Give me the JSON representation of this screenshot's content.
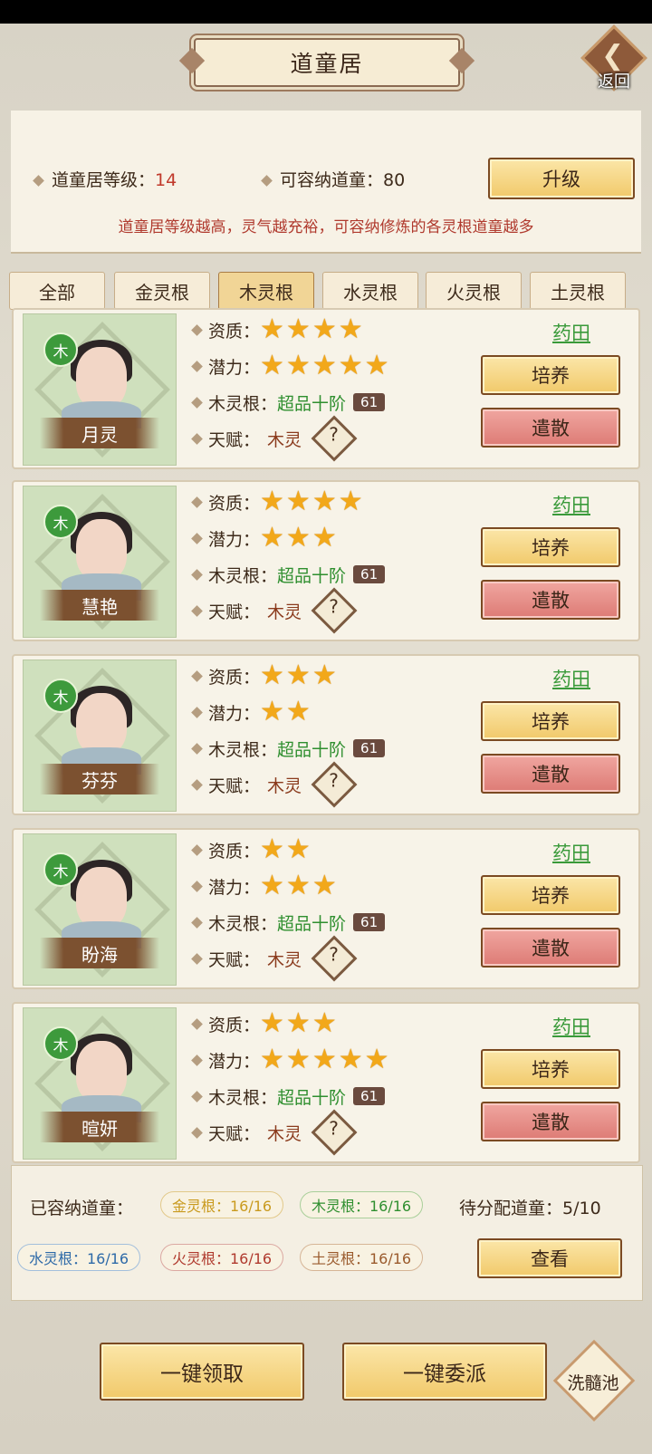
{
  "header": {
    "title": "道童居",
    "back_label": "返回"
  },
  "info": {
    "level_label": "道童居等级：",
    "level_value": "14",
    "capacity_label": "可容纳道童：",
    "capacity_value": "80",
    "upgrade_label": "升级",
    "hint": "道童居等级越高，灵气越充裕，可容纳修炼的各灵根道童越多"
  },
  "tabs": [
    "全部",
    "金灵根",
    "木灵根",
    "水灵根",
    "火灵根",
    "土灵根"
  ],
  "active_tab": "木灵根",
  "labels": {
    "aptitude": "资质：",
    "potential": "潜力：",
    "root": "木灵根：",
    "talent": "天赋：",
    "field": "药田",
    "cultivate": "培养",
    "dismiss": "遣散",
    "question": "?"
  },
  "disciples": [
    {
      "name": "月灵",
      "element": "木",
      "aptitude_stars": 4,
      "potential_stars": 5,
      "grade": "超品十阶",
      "level": "61",
      "talent": "木灵"
    },
    {
      "name": "慧艳",
      "element": "木",
      "aptitude_stars": 4,
      "potential_stars": 3,
      "grade": "超品十阶",
      "level": "61",
      "talent": "木灵"
    },
    {
      "name": "芬芬",
      "element": "木",
      "aptitude_stars": 3,
      "potential_stars": 2,
      "grade": "超品十阶",
      "level": "61",
      "talent": "木灵"
    },
    {
      "name": "盼海",
      "element": "木",
      "aptitude_stars": 2,
      "potential_stars": 3,
      "grade": "超品十阶",
      "level": "61",
      "talent": "木灵"
    },
    {
      "name": "暄妍",
      "element": "木",
      "aptitude_stars": 3,
      "potential_stars": 5,
      "grade": "超品十阶",
      "level": "61",
      "talent": "木灵"
    }
  ],
  "capacity": {
    "label": "已容纳道童：",
    "gold": "金灵根：16/16",
    "wood": "木灵根：16/16",
    "water": "水灵根：16/16",
    "fire": "火灵根：16/16",
    "earth": "土灵根：16/16",
    "pending_label": "待分配道童：",
    "pending_value": "5/10",
    "view_label": "查看"
  },
  "colors": {
    "gold": "#c99a1e",
    "wood": "#2f8f2f",
    "water": "#2e6aa8",
    "fire": "#b03a2e",
    "earth": "#9a5a2c"
  },
  "footer": {
    "collect_all": "一键领取",
    "assign_all": "一键委派",
    "pool": "洗髓池"
  }
}
